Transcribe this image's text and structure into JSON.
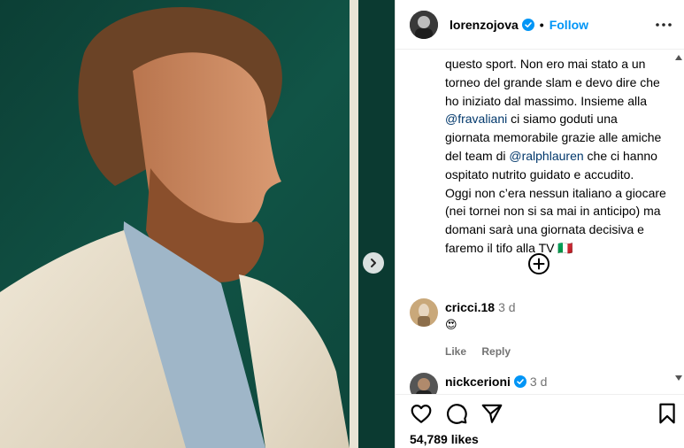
{
  "header": {
    "username": "lorenzojova",
    "separator": "•",
    "follow_label": "Follow"
  },
  "caption": {
    "line1": "questo sport. Non ero mai stato a un",
    "line2": "torneo del grande slam e devo dire che",
    "line3": "ho iniziato dal massimo. Insieme alla",
    "mention1": "@fravaliani",
    "line4_rest": " ci siamo goduti una",
    "line5": "giornata memorabile grazie alle amiche",
    "line6_start": "del team di ",
    "mention2": "@ralphlauren",
    "line6_rest": " che ci hanno",
    "line7": "ospitato nutrito guidato e accudito.",
    "line8": "Oggi non c’era nessun italiano a giocare",
    "line9": "(nei tornei non si sa mai in anticipo) ma",
    "line10": "domani sarà una giornata decisiva e",
    "line11": "faremo il tifo alla TV 🇮🇹"
  },
  "comments": [
    {
      "username": "cricci.18",
      "time": "3 d",
      "text": "😍",
      "like_label": "Like",
      "reply_label": "Reply"
    },
    {
      "username": "nickcerioni",
      "time": "3 d"
    }
  ],
  "footer": {
    "likes": "54,789 likes"
  },
  "icons": {
    "verified": "verified-badge-icon",
    "more": "more-options-icon",
    "add": "add-circle-icon",
    "like": "heart-icon",
    "comment": "comment-icon",
    "share": "send-icon",
    "save": "bookmark-icon",
    "next": "chevron-right-icon"
  },
  "colors": {
    "follow": "#0095f6",
    "mention": "#00376b",
    "verified": "#0095f6",
    "muted": "#737373"
  }
}
